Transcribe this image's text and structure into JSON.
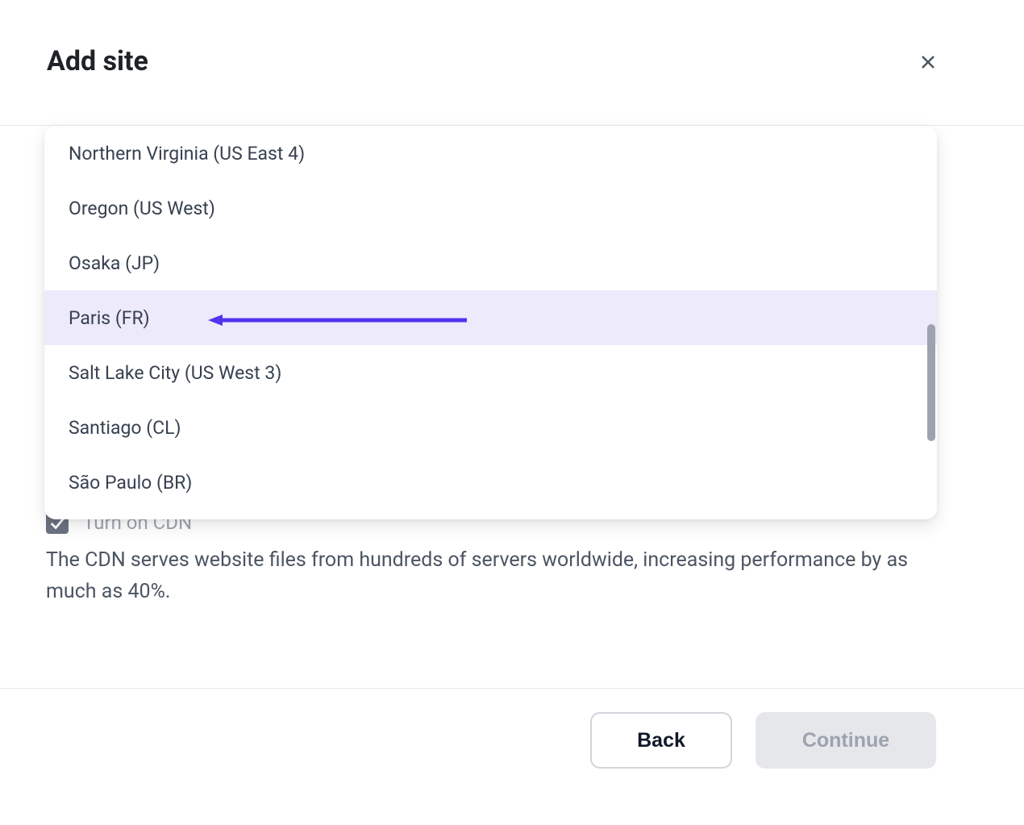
{
  "header": {
    "title": "Add site"
  },
  "dropdown": {
    "options": [
      {
        "label": "Northern Virginia (US East 4)",
        "highlighted": false
      },
      {
        "label": "Oregon (US West)",
        "highlighted": false
      },
      {
        "label": "Osaka (JP)",
        "highlighted": false
      },
      {
        "label": "Paris (FR)",
        "highlighted": true
      },
      {
        "label": "Salt Lake City (US West 3)",
        "highlighted": false
      },
      {
        "label": "Santiago (CL)",
        "highlighted": false
      },
      {
        "label": "São Paulo (BR)",
        "highlighted": false
      }
    ]
  },
  "cdn": {
    "checkbox_checked": true,
    "label": "Turn on CDN",
    "description": "The CDN serves website files from hundreds of servers worldwide, increasing performance by as much as 40%."
  },
  "footer": {
    "back_label": "Back",
    "continue_label": "Continue",
    "continue_disabled": true
  },
  "colors": {
    "accent": "#5333ed",
    "dropdown_highlight": "#eceafb"
  }
}
